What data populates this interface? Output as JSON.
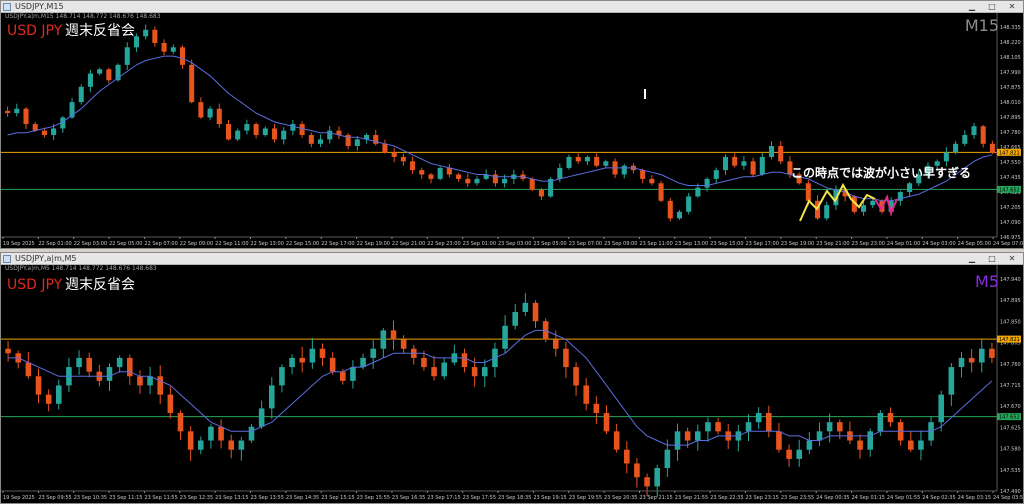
{
  "colors": {
    "background": "#000000",
    "bull": "#26a69a",
    "bear": "#e8541e",
    "ma": "#5b6ee1",
    "orange_line": "#f0a500",
    "green_line": "#26a65b",
    "symbol_text": "#e0281e",
    "timeframe_m15": "#8c8c8c",
    "timeframe_m5": "#8a2be2",
    "annotation_yellow": "#f2e64a",
    "annotation_pink": "#e0288c"
  },
  "top_window": {
    "title": "USDJPY,M15",
    "info": "USDJPY.a|m,M15 148.714 148.772 148.676 148.683",
    "symbol_label": "USD JPY",
    "review_label": "週末反省会",
    "timeframe": "M15",
    "annotation": "この時点では波が小さい早すぎる"
  },
  "bottom_window": {
    "title": "USDJPY,a|m,M5",
    "info": "USDJPY.a|m,M5 148.714 148.772 148.676 148.683",
    "symbol_label": "USD JPY",
    "review_label": "週末反省会",
    "timeframe": "M5"
  },
  "window_buttons": {
    "minimize": "▁",
    "maximize": "□",
    "close": "✕"
  },
  "chart_data": [
    {
      "type": "candlestick",
      "name": "M15",
      "y_range": [
        147.435,
        148.42
      ],
      "price_ticks": [
        "148.335",
        "148.220",
        "148.105",
        "147.990",
        "147.875",
        "148.010",
        "147.895",
        "147.780",
        "147.665",
        "147.550",
        "147.435",
        "147.320",
        "147.205",
        "147.090",
        "146.975"
      ],
      "orange_level": 147.821,
      "orange_label": "147.821",
      "green_level": 147.652,
      "green_label": "147.652",
      "time_ticks": [
        "19 Sep 2025",
        "22 Sep 01:00",
        "22 Sep 03:00",
        "22 Sep 05:00",
        "22 Sep 07:00",
        "22 Sep 09:00",
        "22 Sep 11:00",
        "22 Sep 13:00",
        "22 Sep 15:00",
        "22 Sep 17:00",
        "22 Sep 19:00",
        "22 Sep 21:00",
        "22 Sep 23:00",
        "23 Sep 01:00",
        "23 Sep 03:00",
        "23 Sep 05:00",
        "23 Sep 07:00",
        "23 Sep 09:00",
        "23 Sep 11:00",
        "23 Sep 13:00",
        "23 Sep 15:00",
        "23 Sep 17:00",
        "23 Sep 19:00",
        "23 Sep 21:00",
        "23 Sep 23:00",
        "24 Sep 01:00",
        "24 Sep 03:00",
        "24 Sep 05:00",
        "24 Sep 07:00"
      ],
      "closes": [
        148.0,
        148.02,
        147.95,
        147.92,
        147.9,
        147.93,
        147.98,
        148.05,
        148.12,
        148.18,
        148.2,
        148.15,
        148.22,
        148.3,
        148.35,
        148.38,
        148.32,
        148.28,
        148.3,
        148.22,
        148.05,
        147.98,
        148.02,
        147.95,
        147.88,
        147.92,
        147.95,
        147.9,
        147.93,
        147.88,
        147.92,
        147.95,
        147.9,
        147.86,
        147.88,
        147.92,
        147.9,
        147.85,
        147.88,
        147.9,
        147.86,
        147.82,
        147.8,
        147.78,
        147.74,
        147.72,
        147.7,
        147.75,
        147.72,
        147.7,
        147.68,
        147.7,
        147.72,
        147.68,
        147.7,
        147.72,
        147.7,
        147.65,
        147.62,
        147.7,
        147.75,
        147.8,
        147.78,
        147.8,
        147.76,
        147.78,
        147.72,
        147.76,
        147.74,
        147.7,
        147.68,
        147.6,
        147.52,
        147.55,
        147.62,
        147.66,
        147.7,
        147.74,
        147.8,
        147.76,
        147.78,
        147.72,
        147.8,
        147.85,
        147.78,
        147.72,
        147.68,
        147.6,
        147.52,
        147.58,
        147.65,
        147.62,
        147.55,
        147.58,
        147.6,
        147.55,
        147.6,
        147.64,
        147.68,
        147.72,
        147.76,
        147.78,
        147.82,
        147.86,
        147.9,
        147.94,
        147.86,
        147.82
      ],
      "ma": [
        147.9,
        147.91,
        147.91,
        147.92,
        147.93,
        147.94,
        147.96,
        147.99,
        148.02,
        148.06,
        148.1,
        148.13,
        148.16,
        148.19,
        148.22,
        148.24,
        148.25,
        148.26,
        148.26,
        148.25,
        148.23,
        148.2,
        148.17,
        148.13,
        148.09,
        148.06,
        148.03,
        148.0,
        147.98,
        147.96,
        147.95,
        147.94,
        147.93,
        147.92,
        147.91,
        147.91,
        147.9,
        147.89,
        147.89,
        147.88,
        147.87,
        147.86,
        147.85,
        147.83,
        147.81,
        147.79,
        147.77,
        147.76,
        147.75,
        147.74,
        147.73,
        147.72,
        147.72,
        147.71,
        147.71,
        147.71,
        147.71,
        147.7,
        147.69,
        147.69,
        147.7,
        147.71,
        147.72,
        147.73,
        147.74,
        147.75,
        147.75,
        147.75,
        147.75,
        147.74,
        147.73,
        147.72,
        147.7,
        147.68,
        147.67,
        147.67,
        147.67,
        147.68,
        147.69,
        147.7,
        147.71,
        147.71,
        147.72,
        147.73,
        147.73,
        147.72,
        147.71,
        147.7,
        147.68,
        147.66,
        147.65,
        147.64,
        147.62,
        147.61,
        147.61,
        147.6,
        147.6,
        147.61,
        147.62,
        147.63,
        147.65,
        147.67,
        147.69,
        147.72,
        147.75,
        147.78,
        147.8,
        147.81
      ]
    },
    {
      "type": "candlestick",
      "name": "M5",
      "y_range": [
        147.49,
        147.965
      ],
      "price_ticks": [
        "147.940",
        "147.895",
        "147.850",
        "147.805",
        "147.760",
        "147.715",
        "147.670",
        "147.625",
        "147.580",
        "147.535",
        "147.490"
      ],
      "orange_level": 147.821,
      "orange_label": "147.821",
      "green_level": 147.652,
      "green_label": "147.652",
      "time_ticks": [
        "19 Sep 2025",
        "23 Sep 09:55",
        "23 Sep 10:35",
        "23 Sep 11:15",
        "23 Sep 11:55",
        "23 Sep 12:35",
        "23 Sep 13:15",
        "23 Sep 13:55",
        "23 Sep 14:35",
        "23 Sep 15:15",
        "23 Sep 15:55",
        "23 Sep 16:35",
        "23 Sep 17:15",
        "23 Sep 17:55",
        "23 Sep 18:35",
        "23 Sep 19:15",
        "23 Sep 19:55",
        "23 Sep 20:35",
        "23 Sep 21:15",
        "23 Sep 21:55",
        "23 Sep 22:35",
        "23 Sep 23:15",
        "23 Sep 23:55",
        "24 Sep 00:35",
        "24 Sep 01:15",
        "24 Sep 01:55",
        "24 Sep 02:35",
        "24 Sep 03:15",
        "24 Sep 03:55"
      ],
      "closes": [
        147.79,
        147.77,
        147.74,
        147.7,
        147.68,
        147.72,
        147.76,
        147.78,
        147.75,
        147.73,
        147.76,
        147.78,
        147.74,
        147.72,
        147.74,
        147.7,
        147.66,
        147.62,
        147.58,
        147.6,
        147.63,
        147.6,
        147.58,
        147.6,
        147.63,
        147.67,
        147.72,
        147.76,
        147.78,
        147.77,
        147.8,
        147.78,
        147.75,
        147.73,
        147.76,
        147.78,
        147.8,
        147.84,
        147.82,
        147.8,
        147.78,
        147.76,
        147.74,
        147.77,
        147.79,
        147.76,
        147.74,
        147.76,
        147.8,
        147.85,
        147.88,
        147.9,
        147.86,
        147.82,
        147.8,
        147.76,
        147.72,
        147.68,
        147.66,
        147.62,
        147.58,
        147.55,
        147.52,
        147.5,
        147.54,
        147.58,
        147.62,
        147.6,
        147.62,
        147.64,
        147.62,
        147.6,
        147.62,
        147.64,
        147.66,
        147.62,
        147.58,
        147.56,
        147.58,
        147.6,
        147.62,
        147.64,
        147.62,
        147.6,
        147.58,
        147.62,
        147.66,
        147.64,
        147.6,
        147.58,
        147.6,
        147.64,
        147.7,
        147.76,
        147.78,
        147.77,
        147.8,
        147.78
      ],
      "ma": [
        147.78,
        147.78,
        147.77,
        147.76,
        147.75,
        147.74,
        147.74,
        147.74,
        147.74,
        147.74,
        147.74,
        147.75,
        147.75,
        147.74,
        147.74,
        147.73,
        147.72,
        147.7,
        147.68,
        147.66,
        147.64,
        147.63,
        147.62,
        147.62,
        147.62,
        147.63,
        147.64,
        147.66,
        147.68,
        147.7,
        147.72,
        147.74,
        147.75,
        147.75,
        147.76,
        147.76,
        147.77,
        147.78,
        147.79,
        147.79,
        147.79,
        147.79,
        147.78,
        147.78,
        147.78,
        147.78,
        147.77,
        147.77,
        147.78,
        147.79,
        147.81,
        147.83,
        147.84,
        147.84,
        147.83,
        147.82,
        147.8,
        147.78,
        147.75,
        147.72,
        147.69,
        147.66,
        147.63,
        147.61,
        147.6,
        147.59,
        147.59,
        147.59,
        147.6,
        147.6,
        147.61,
        147.61,
        147.61,
        147.62,
        147.62,
        147.62,
        147.62,
        147.61,
        147.61,
        147.6,
        147.6,
        147.61,
        147.61,
        147.61,
        147.61,
        147.61,
        147.62,
        147.62,
        147.62,
        147.62,
        147.62,
        147.62,
        147.63,
        147.65,
        147.67,
        147.69,
        147.71,
        147.73
      ]
    }
  ]
}
